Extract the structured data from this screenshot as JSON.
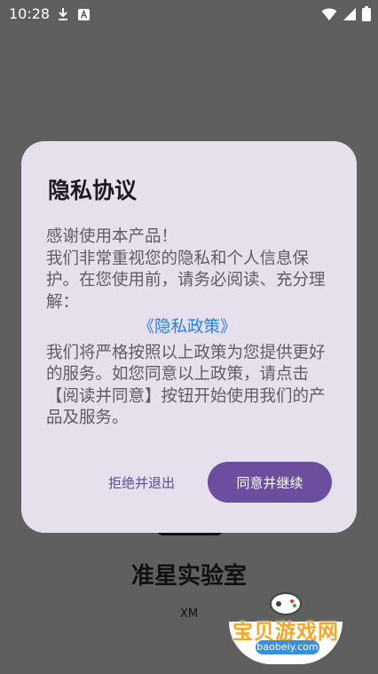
{
  "status_bar": {
    "time": "10:28",
    "left_icons": [
      "download-icon",
      "a-badge-icon"
    ],
    "right_icons": [
      "wifi-icon",
      "signal-icon",
      "battery-icon"
    ]
  },
  "app": {
    "title": "准星实验室",
    "subtitle": "XM"
  },
  "dialog": {
    "title": "隐私协议",
    "body_intro": "感谢使用本产品！\n我们非常重视您的隐私和个人信息保护。在您使用前，请务必阅读、充分理解：",
    "policy_link": "《隐私政策》",
    "body_outro": "我们将严格按照以上政策为您提供更好的服务。如您同意以上政策，请点击【阅读并同意】按钮开始使用我们的产品及服务。",
    "decline_label": "拒绝并退出",
    "agree_label": "同意并继续"
  },
  "watermark": {
    "text": "宝贝游戏网",
    "url": "baobeiy.com"
  },
  "colors": {
    "accent": "#6b4f9e",
    "link": "#2f7fd4",
    "dialog_bg": "#e6e0ec",
    "scrim": "#5f5f5f"
  }
}
